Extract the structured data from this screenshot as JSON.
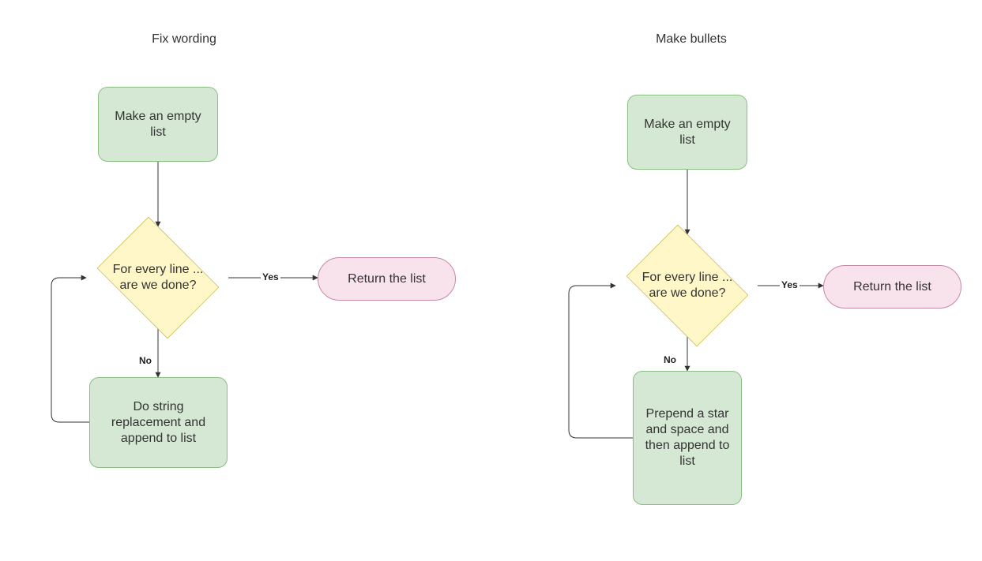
{
  "left": {
    "title": "Fix wording",
    "start": "Make an empty list",
    "decision": "For every line ... are we done?",
    "yes_label": "Yes",
    "no_label": "No",
    "loop_body": "Do string replacement and append to list",
    "terminator": "Return the list"
  },
  "right": {
    "title": "Make bullets",
    "start": "Make an empty list",
    "decision": "For every line ... are we done?",
    "yes_label": "Yes",
    "no_label": "No",
    "loop_body": "Prepend a star and space and then append to list",
    "terminator": "Return the list"
  },
  "colors": {
    "process_fill": "#d5e8d4",
    "process_stroke": "#8bbf83",
    "decision_fill": "#fff7c8",
    "decision_stroke": "#c8b94a",
    "terminator_fill": "#f8e2ec",
    "terminator_stroke": "#c58aa8",
    "edge": "#333333"
  }
}
